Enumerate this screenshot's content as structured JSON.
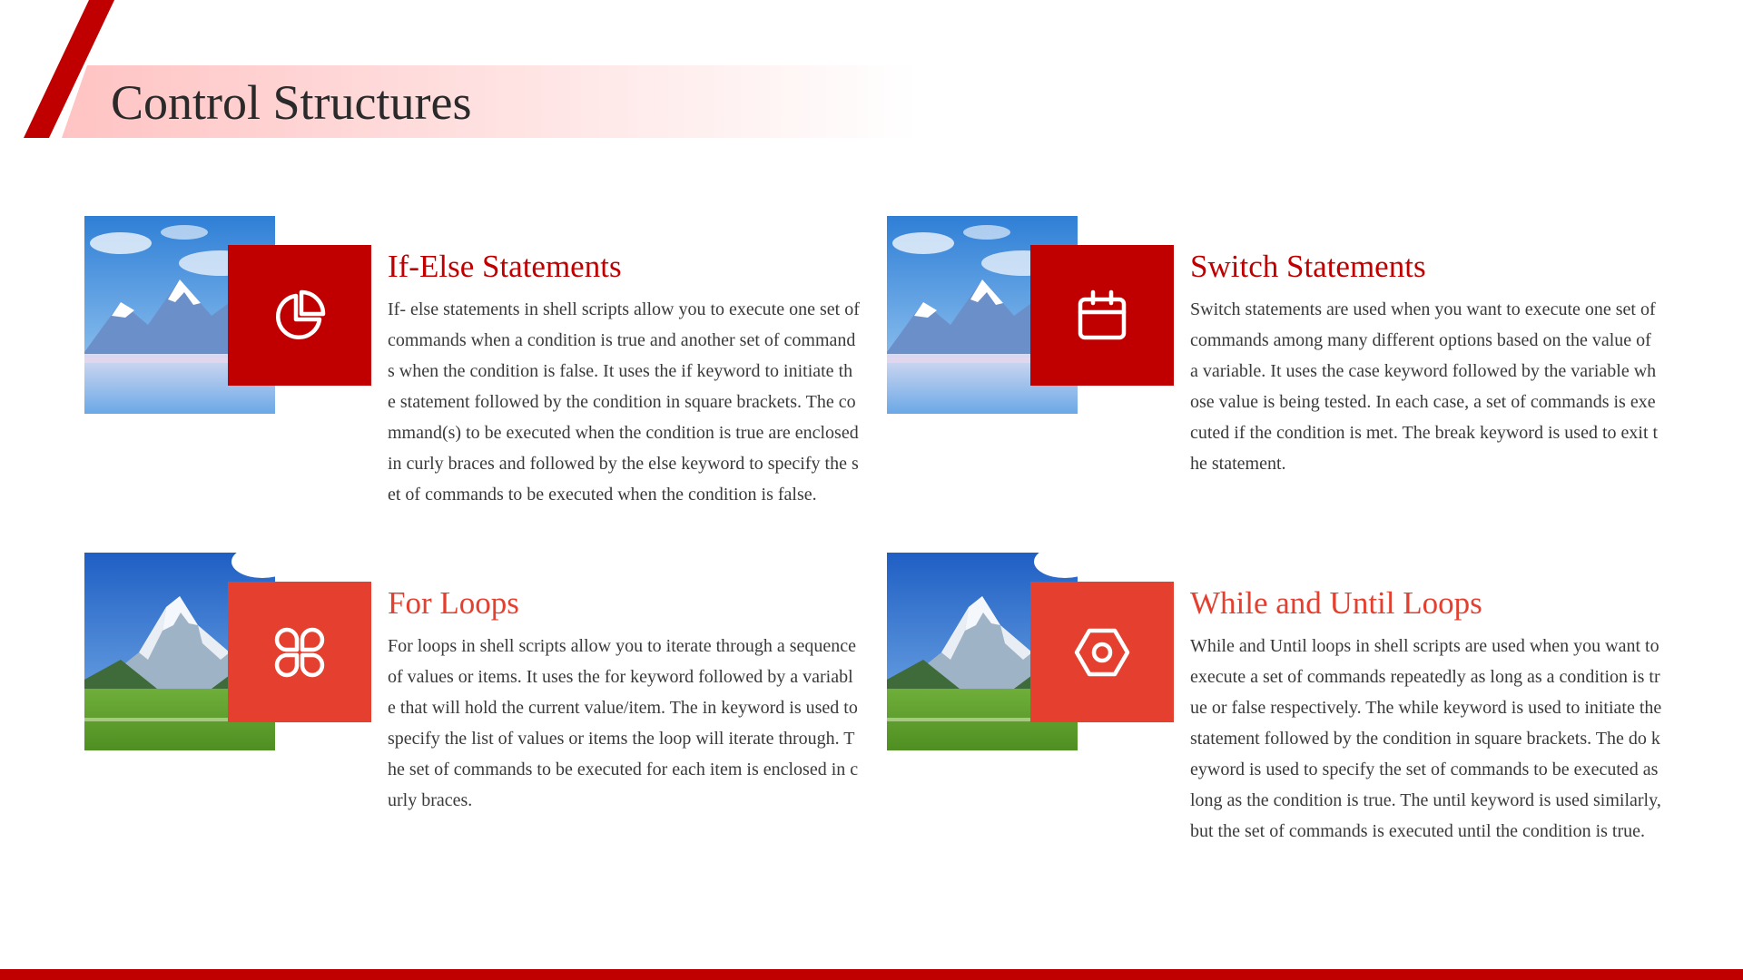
{
  "slide": {
    "title": "Control Structures",
    "accent_color": "#c00000",
    "secondary_accent_color": "#e43f2f"
  },
  "cards": [
    {
      "title": "If-Else Statements",
      "icon": "pie-chart-icon",
      "image": "snowy-mountains-photo",
      "body": "If- else statements in shell scripts allow you to execute one set of commands when a condition is true and another set of commands when the condition is false. It uses the if keyword to initiate the statement followed by the condition in square brackets. The command(s) to be executed when the condition is true are enclosed in curly braces and followed by the else keyword to specify the set of commands to be executed when the condition is false."
    },
    {
      "title": "Switch Statements",
      "icon": "calendar-icon",
      "image": "snowy-mountains-photo",
      "body": "Switch statements are used when you want to execute one set of commands among many different options based on the value of a variable. It uses the case keyword followed by the variable whose value is being tested. In each case, a set of commands is executed if the condition is met. The break keyword is used to exit the statement."
    },
    {
      "title": "For Loops",
      "icon": "four-petal-grid-icon",
      "image": "mountain-meadow-photo",
      "body": "For loops in shell scripts allow you to iterate through a sequence of values or items. It uses the for keyword followed by a variable that will hold the current value/item. The in keyword is used to specify the list of values or items the loop will iterate through. The set of commands to be executed for each item is enclosed in curly braces."
    },
    {
      "title": "While and Until Loops",
      "icon": "hex-nut-icon",
      "image": "mountain-meadow-photo",
      "body": "While and Until loops in shell scripts are used when you want to execute a set of commands repeatedly as long as a  condition is true or false respectively. The while keyword  is used to initiate the statement followed by the condition in square brackets. The do keyword is used to specify the set of commands to be executed as long as the condition is  true. The until keyword is used similarly, but the set of commands is executed until the condition is true."
    }
  ]
}
